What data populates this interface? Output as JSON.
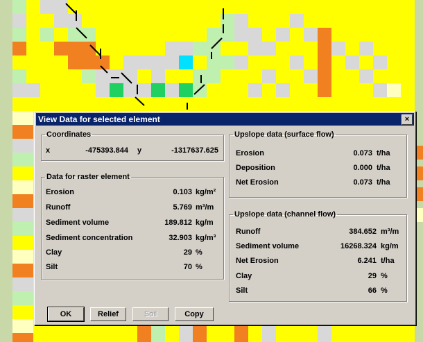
{
  "dialog": {
    "title": "View Data for selected element",
    "close_label": "×"
  },
  "coordinates": {
    "legend": "Coordinates",
    "x_label": "x",
    "x_value": "-475393.844",
    "y_label": "y",
    "y_value": "-1317637.625"
  },
  "raster": {
    "legend": "Data for raster element",
    "rows": [
      {
        "label": "Erosion",
        "value": "0.103",
        "unit": "kg/m²"
      },
      {
        "label": "Runoff",
        "value": "5.769",
        "unit": "m³/m"
      },
      {
        "label": "Sediment volume",
        "value": "189.812",
        "unit": "kg/m"
      },
      {
        "label": "Sediment concentration",
        "value": "32.903",
        "unit": "kg/m³"
      },
      {
        "label": "Clay",
        "value": "29",
        "unit": "%"
      },
      {
        "label": "Silt",
        "value": "70",
        "unit": "%"
      }
    ]
  },
  "surface": {
    "legend": "Upslope data (surface flow)",
    "rows": [
      {
        "label": "Erosion",
        "value": "0.073",
        "unit": "t/ha"
      },
      {
        "label": "Deposition",
        "value": "0.000",
        "unit": "t/ha"
      },
      {
        "label": "Net Erosion",
        "value": "0.073",
        "unit": "t/ha"
      }
    ]
  },
  "channel": {
    "legend": "Upslope data (channel flow)",
    "rows": [
      {
        "label": "Runoff",
        "value": "384.652",
        "unit": "m³/m"
      },
      {
        "label": "Sediment volume",
        "value": "16268.324",
        "unit": "kg/m"
      },
      {
        "label": "Net Erosion",
        "value": "6.241",
        "unit": "t/ha"
      },
      {
        "label": "Clay",
        "value": "29",
        "unit": "%"
      },
      {
        "label": "Silt",
        "value": "66",
        "unit": "%"
      }
    ]
  },
  "buttons": {
    "ok": "OK",
    "relief": "Relief",
    "soil": "Soil",
    "copy": "Copy"
  },
  "colors": {
    "map_yellow": "#ffff00",
    "map_grey": "#d8d8d8",
    "map_green": "#c0f0b0",
    "map_orange": "#f08020",
    "map_cream": "#ffffc0",
    "title_bar": "#0a246a",
    "dialog_face": "#d4d0c8"
  }
}
